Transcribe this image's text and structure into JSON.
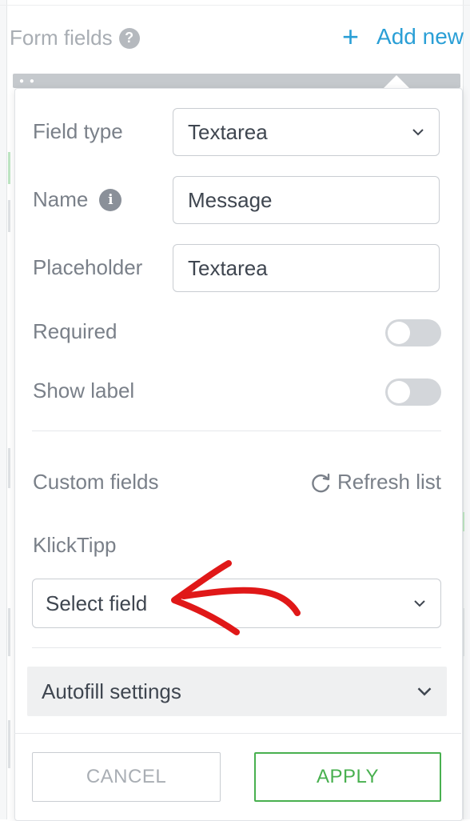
{
  "header": {
    "title": "Form fields",
    "help_icon": "?",
    "add_new_label": "Add new",
    "add_icon": "plus-icon"
  },
  "popup": {
    "field_type": {
      "label": "Field type",
      "value": "Textarea"
    },
    "name": {
      "label": "Name",
      "value": "Message",
      "info_icon": "i"
    },
    "placeholder": {
      "label": "Placeholder",
      "value": "Textarea"
    },
    "required": {
      "label": "Required",
      "on": false
    },
    "show_label": {
      "label": "Show label",
      "on": false
    },
    "custom_fields": {
      "label": "Custom fields",
      "refresh_label": "Refresh list",
      "refresh_icon": "refresh-icon"
    },
    "provider": {
      "label": "KlickTipp",
      "select_value": "Select field"
    },
    "autofill": {
      "label": "Autofill settings"
    },
    "buttons": {
      "cancel": "CANCEL",
      "apply": "APPLY"
    }
  },
  "annotation": {
    "arrow_color": "#e01818",
    "points_to": "select-field-dropdown"
  },
  "colors": {
    "accent": "#2a9fd6",
    "apply_green": "#48b04f",
    "toggle_off": "#d3d6da"
  }
}
